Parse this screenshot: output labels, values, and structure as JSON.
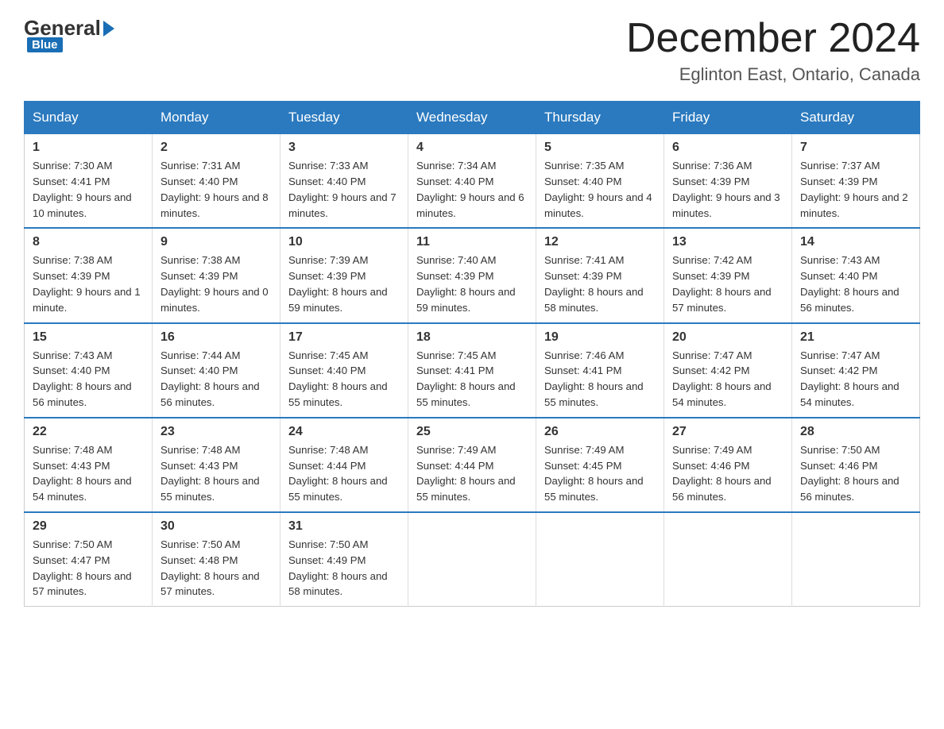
{
  "header": {
    "title": "December 2024",
    "subtitle": "Eglinton East, Ontario, Canada"
  },
  "logo": {
    "part1": "General",
    "part2": "Blue"
  },
  "days_of_week": [
    "Sunday",
    "Monday",
    "Tuesday",
    "Wednesday",
    "Thursday",
    "Friday",
    "Saturday"
  ],
  "weeks": [
    [
      {
        "day": "1",
        "sunrise": "7:30 AM",
        "sunset": "4:41 PM",
        "daylight": "9 hours and 10 minutes."
      },
      {
        "day": "2",
        "sunrise": "7:31 AM",
        "sunset": "4:40 PM",
        "daylight": "9 hours and 8 minutes."
      },
      {
        "day": "3",
        "sunrise": "7:33 AM",
        "sunset": "4:40 PM",
        "daylight": "9 hours and 7 minutes."
      },
      {
        "day": "4",
        "sunrise": "7:34 AM",
        "sunset": "4:40 PM",
        "daylight": "9 hours and 6 minutes."
      },
      {
        "day": "5",
        "sunrise": "7:35 AM",
        "sunset": "4:40 PM",
        "daylight": "9 hours and 4 minutes."
      },
      {
        "day": "6",
        "sunrise": "7:36 AM",
        "sunset": "4:39 PM",
        "daylight": "9 hours and 3 minutes."
      },
      {
        "day": "7",
        "sunrise": "7:37 AM",
        "sunset": "4:39 PM",
        "daylight": "9 hours and 2 minutes."
      }
    ],
    [
      {
        "day": "8",
        "sunrise": "7:38 AM",
        "sunset": "4:39 PM",
        "daylight": "9 hours and 1 minute."
      },
      {
        "day": "9",
        "sunrise": "7:38 AM",
        "sunset": "4:39 PM",
        "daylight": "9 hours and 0 minutes."
      },
      {
        "day": "10",
        "sunrise": "7:39 AM",
        "sunset": "4:39 PM",
        "daylight": "8 hours and 59 minutes."
      },
      {
        "day": "11",
        "sunrise": "7:40 AM",
        "sunset": "4:39 PM",
        "daylight": "8 hours and 59 minutes."
      },
      {
        "day": "12",
        "sunrise": "7:41 AM",
        "sunset": "4:39 PM",
        "daylight": "8 hours and 58 minutes."
      },
      {
        "day": "13",
        "sunrise": "7:42 AM",
        "sunset": "4:39 PM",
        "daylight": "8 hours and 57 minutes."
      },
      {
        "day": "14",
        "sunrise": "7:43 AM",
        "sunset": "4:40 PM",
        "daylight": "8 hours and 56 minutes."
      }
    ],
    [
      {
        "day": "15",
        "sunrise": "7:43 AM",
        "sunset": "4:40 PM",
        "daylight": "8 hours and 56 minutes."
      },
      {
        "day": "16",
        "sunrise": "7:44 AM",
        "sunset": "4:40 PM",
        "daylight": "8 hours and 56 minutes."
      },
      {
        "day": "17",
        "sunrise": "7:45 AM",
        "sunset": "4:40 PM",
        "daylight": "8 hours and 55 minutes."
      },
      {
        "day": "18",
        "sunrise": "7:45 AM",
        "sunset": "4:41 PM",
        "daylight": "8 hours and 55 minutes."
      },
      {
        "day": "19",
        "sunrise": "7:46 AM",
        "sunset": "4:41 PM",
        "daylight": "8 hours and 55 minutes."
      },
      {
        "day": "20",
        "sunrise": "7:47 AM",
        "sunset": "4:42 PM",
        "daylight": "8 hours and 54 minutes."
      },
      {
        "day": "21",
        "sunrise": "7:47 AM",
        "sunset": "4:42 PM",
        "daylight": "8 hours and 54 minutes."
      }
    ],
    [
      {
        "day": "22",
        "sunrise": "7:48 AM",
        "sunset": "4:43 PM",
        "daylight": "8 hours and 54 minutes."
      },
      {
        "day": "23",
        "sunrise": "7:48 AM",
        "sunset": "4:43 PM",
        "daylight": "8 hours and 55 minutes."
      },
      {
        "day": "24",
        "sunrise": "7:48 AM",
        "sunset": "4:44 PM",
        "daylight": "8 hours and 55 minutes."
      },
      {
        "day": "25",
        "sunrise": "7:49 AM",
        "sunset": "4:44 PM",
        "daylight": "8 hours and 55 minutes."
      },
      {
        "day": "26",
        "sunrise": "7:49 AM",
        "sunset": "4:45 PM",
        "daylight": "8 hours and 55 minutes."
      },
      {
        "day": "27",
        "sunrise": "7:49 AM",
        "sunset": "4:46 PM",
        "daylight": "8 hours and 56 minutes."
      },
      {
        "day": "28",
        "sunrise": "7:50 AM",
        "sunset": "4:46 PM",
        "daylight": "8 hours and 56 minutes."
      }
    ],
    [
      {
        "day": "29",
        "sunrise": "7:50 AM",
        "sunset": "4:47 PM",
        "daylight": "8 hours and 57 minutes."
      },
      {
        "day": "30",
        "sunrise": "7:50 AM",
        "sunset": "4:48 PM",
        "daylight": "8 hours and 57 minutes."
      },
      {
        "day": "31",
        "sunrise": "7:50 AM",
        "sunset": "4:49 PM",
        "daylight": "8 hours and 58 minutes."
      },
      {
        "day": "",
        "sunrise": "",
        "sunset": "",
        "daylight": ""
      },
      {
        "day": "",
        "sunrise": "",
        "sunset": "",
        "daylight": ""
      },
      {
        "day": "",
        "sunrise": "",
        "sunset": "",
        "daylight": ""
      },
      {
        "day": "",
        "sunrise": "",
        "sunset": "",
        "daylight": ""
      }
    ]
  ],
  "labels": {
    "sunrise_prefix": "Sunrise: ",
    "sunset_prefix": "Sunset: ",
    "daylight_prefix": "Daylight: "
  }
}
